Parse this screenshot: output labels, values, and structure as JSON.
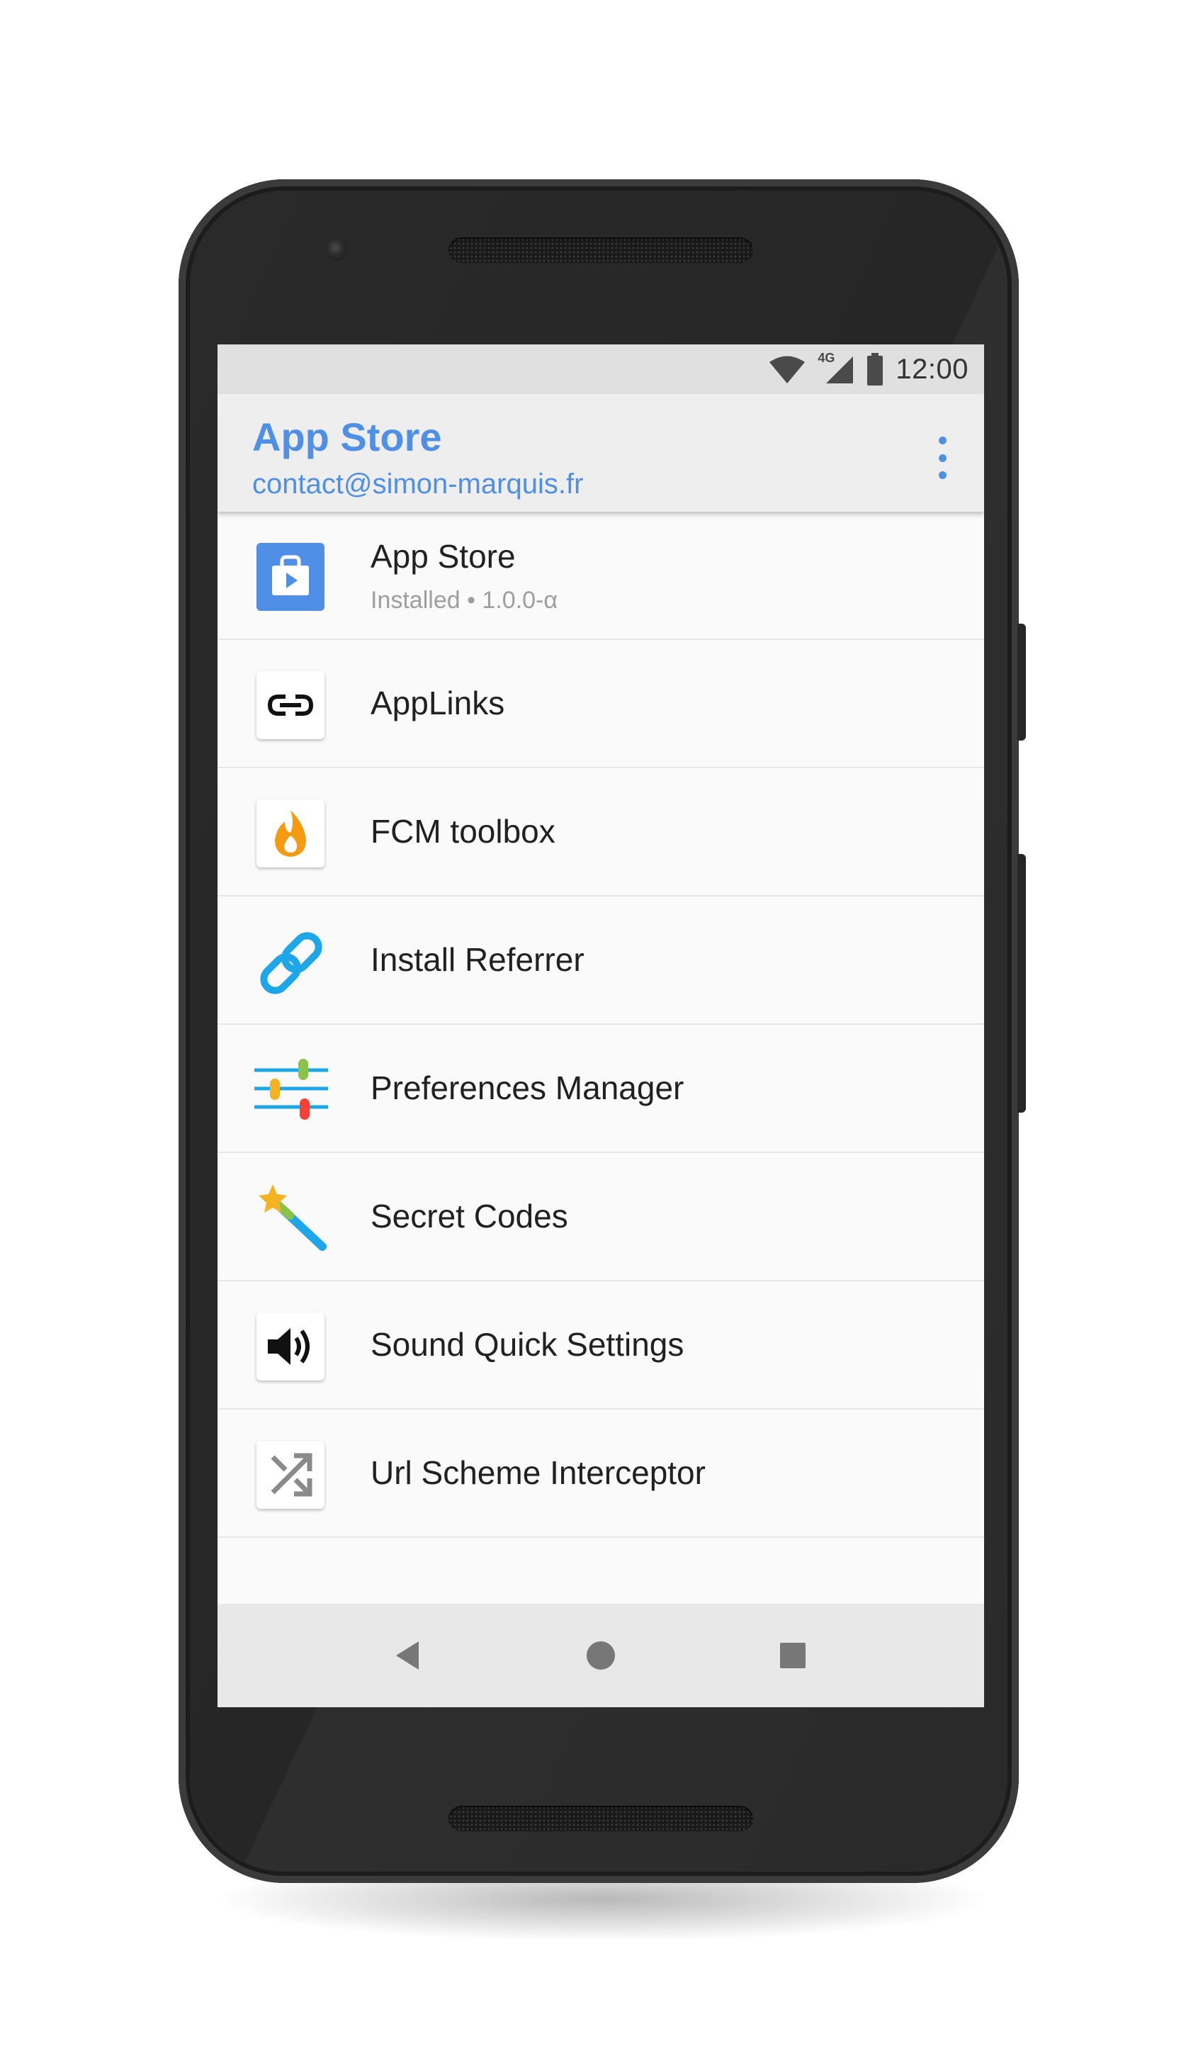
{
  "status_bar": {
    "network": "4G",
    "time": "12:00"
  },
  "app_bar": {
    "title": "App Store",
    "subtitle": "contact@simon-marquis.fr",
    "menu_icon": "more-vert-icon"
  },
  "apps": [
    {
      "name": "App Store",
      "subtitle": "Installed • 1.0.0-α",
      "icon": "app-store-icon"
    },
    {
      "name": "AppLinks",
      "icon": "link-icon"
    },
    {
      "name": "FCM toolbox",
      "icon": "flame-icon"
    },
    {
      "name": "Install Referrer",
      "icon": "chain-link-icon"
    },
    {
      "name": "Preferences Manager",
      "icon": "sliders-icon"
    },
    {
      "name": "Secret Codes",
      "icon": "magic-wand-icon"
    },
    {
      "name": "Sound Quick Settings",
      "icon": "volume-icon"
    },
    {
      "name": "Url Scheme Interceptor",
      "icon": "shuffle-icon"
    }
  ],
  "nav_bar": {
    "back_icon": "back-triangle-icon",
    "home_icon": "home-circle-icon",
    "recents_icon": "recents-square-icon"
  },
  "colors": {
    "accent": "#4f8fe6",
    "app_bar": "#eeeeee",
    "status_bar": "#e0e0e0",
    "list_bg": "#fafafa"
  }
}
